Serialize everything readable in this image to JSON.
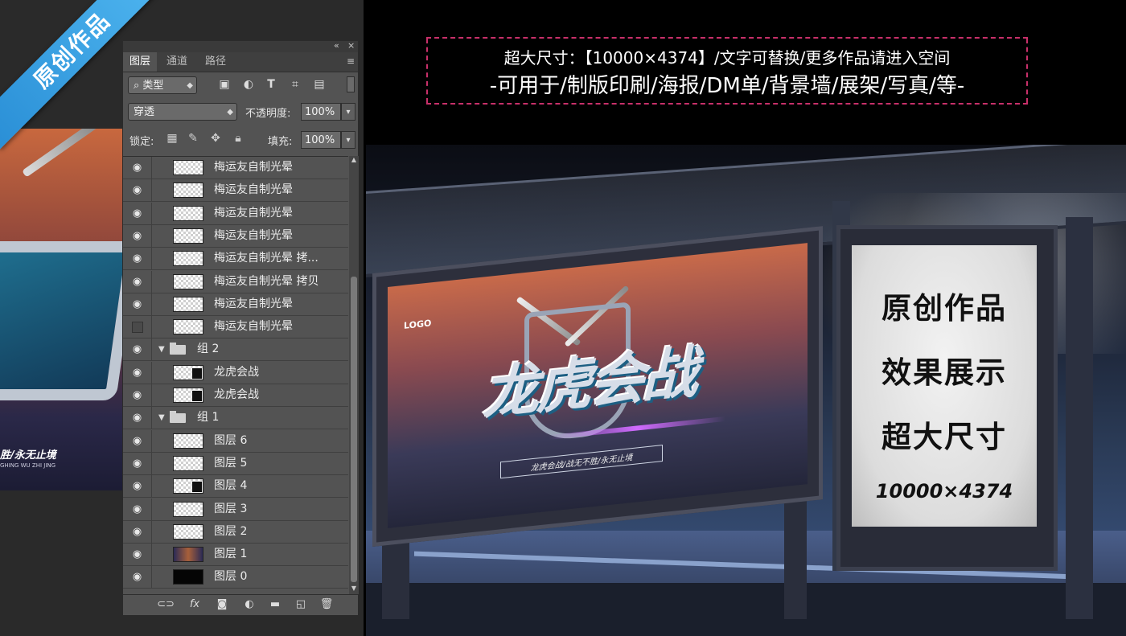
{
  "ribbon": {
    "text": "原创作品"
  },
  "poster_preview": {
    "tagline": "胜/永无止境",
    "tagline_sub": "GHING WU ZHI JING"
  },
  "layers_panel": {
    "tabs": [
      {
        "label": "图层",
        "active": true
      },
      {
        "label": "通道",
        "active": false
      },
      {
        "label": "路径",
        "active": false
      }
    ],
    "filter_kind": "类型",
    "filter_icons": [
      "image-filter-icon",
      "adjustment-filter-icon",
      "type-filter-icon",
      "shape-filter-icon",
      "smart-object-filter-icon"
    ],
    "blend_mode": "穿透",
    "opacity_label": "不透明度:",
    "opacity_value": "100%",
    "lock_label": "锁定:",
    "lock_icons": [
      "lock-transparent-icon",
      "lock-image-icon",
      "lock-position-icon",
      "lock-all-icon"
    ],
    "fill_label": "填充:",
    "fill_value": "100%",
    "layers": [
      {
        "type": "layer",
        "name": "梅运友自制光晕",
        "visible": true,
        "thumb": "transparent",
        "indent": 1
      },
      {
        "type": "layer",
        "name": "梅运友自制光晕",
        "visible": true,
        "thumb": "transparent",
        "indent": 1
      },
      {
        "type": "layer",
        "name": "梅运友自制光晕",
        "visible": true,
        "thumb": "transparent",
        "indent": 1
      },
      {
        "type": "layer",
        "name": "梅运友自制光晕",
        "visible": true,
        "thumb": "transparent",
        "indent": 1
      },
      {
        "type": "layer",
        "name": "梅运友自制光晕 拷...",
        "visible": true,
        "thumb": "transparent",
        "indent": 1
      },
      {
        "type": "layer",
        "name": "梅运友自制光晕 拷贝",
        "visible": true,
        "thumb": "transparent",
        "indent": 1
      },
      {
        "type": "layer",
        "name": "梅运友自制光晕",
        "visible": true,
        "thumb": "transparent",
        "indent": 1
      },
      {
        "type": "layer",
        "name": "梅运友自制光晕",
        "visible": false,
        "thumb": "transparent",
        "indent": 1
      },
      {
        "type": "group",
        "name": "组 2",
        "visible": true,
        "expanded": true
      },
      {
        "type": "layer",
        "name": "龙虎会战",
        "visible": true,
        "thumb": "mask",
        "indent": 1
      },
      {
        "type": "layer",
        "name": "龙虎会战",
        "visible": true,
        "thumb": "mask",
        "indent": 1
      },
      {
        "type": "group",
        "name": "组 1",
        "visible": true,
        "expanded": true
      },
      {
        "type": "layer",
        "name": "图层 6",
        "visible": true,
        "thumb": "transparent",
        "indent": 1
      },
      {
        "type": "layer",
        "name": "图层 5",
        "visible": true,
        "thumb": "transparent",
        "indent": 1
      },
      {
        "type": "layer",
        "name": "图层 4",
        "visible": true,
        "thumb": "mask",
        "indent": 1
      },
      {
        "type": "layer",
        "name": "图层 3",
        "visible": true,
        "thumb": "transparent",
        "indent": 1
      },
      {
        "type": "layer",
        "name": "图层 2",
        "visible": true,
        "thumb": "transparent",
        "indent": 1
      },
      {
        "type": "layer",
        "name": "图层 1",
        "visible": true,
        "thumb": "photo",
        "indent": 1
      },
      {
        "type": "layer",
        "name": "图层 0",
        "visible": true,
        "thumb": "dark",
        "indent": 1
      }
    ],
    "footer_icons": [
      "link-layers-icon",
      "fx-icon",
      "add-mask-icon",
      "adjustment-layer-icon",
      "new-group-icon",
      "new-layer-icon",
      "delete-layer-icon"
    ]
  },
  "caption": {
    "line1": "超大尺寸：【10000×4374】/文字可替换/更多作品请进入空间",
    "line2": "-可用于/制版印刷/海报/DM单/背景墙/展架/写真/等-"
  },
  "billboard": {
    "logo": "LOGO",
    "title": "龙虎会战",
    "tagline": "龙虎会战/战无不胜/永无止境"
  },
  "lightbox": {
    "line1": "原创作品",
    "line2": "效果展示",
    "line3": "超大尺寸",
    "size": "10000×4374"
  },
  "colors": {
    "ribbon": "#3aa3e4",
    "caption_border": "#c8306a",
    "panel_bg": "#535353"
  }
}
